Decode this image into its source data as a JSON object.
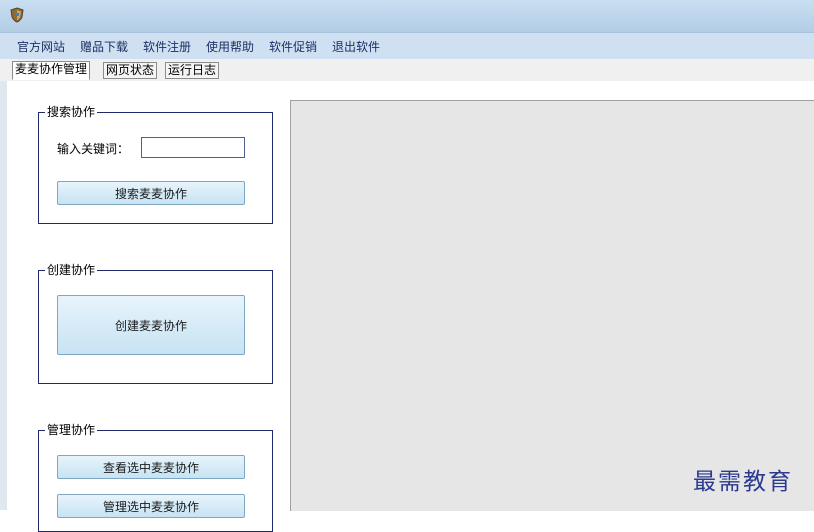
{
  "menu": {
    "items": [
      "官方网站",
      "赠品下载",
      "软件注册",
      "使用帮助",
      "软件促销",
      "退出软件"
    ]
  },
  "tabs": [
    "麦麦协作管理",
    "网页状态",
    "运行日志"
  ],
  "search_group": {
    "legend": "搜索协作",
    "keyword_label": "输入关键词：",
    "keyword_value": "",
    "keyword_placeholder": "",
    "search_button": "搜索麦麦协作"
  },
  "create_group": {
    "legend": "创建协作",
    "create_button": "创建麦麦协作"
  },
  "manage_group": {
    "legend": "管理协作",
    "view_button": "查看选中麦麦协作",
    "manage_button": "管理选中麦麦协作"
  },
  "watermark": "最需教育",
  "colors": {
    "titlebar": "#c9def1",
    "menubar": "#cfe0f2",
    "button": "#c7e3f3",
    "groupbox_border": "#1f2a6b",
    "panel": "#e6e6e6",
    "watermark": "#2a3a8e"
  }
}
